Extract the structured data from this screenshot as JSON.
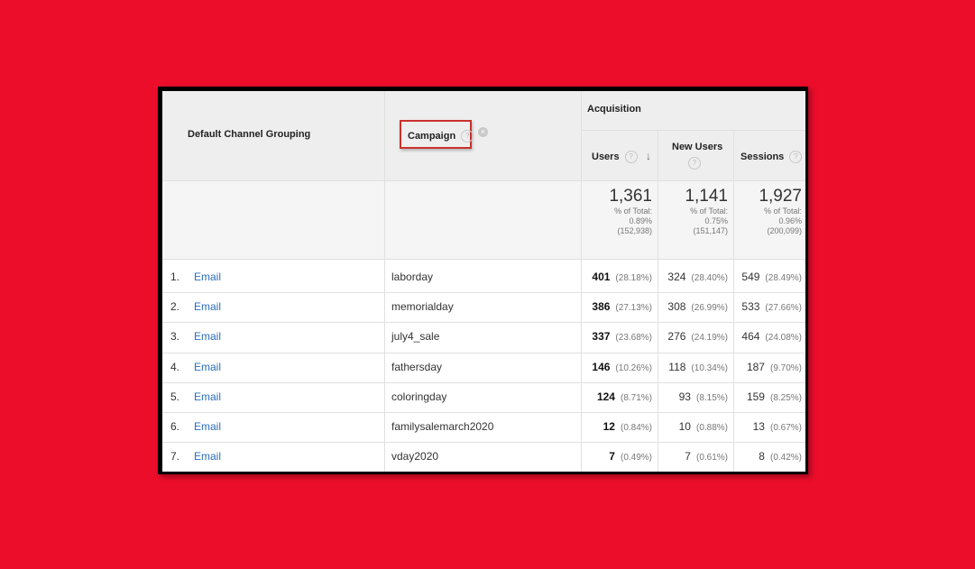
{
  "header": {
    "dimension1": "Default Channel Grouping",
    "dimension2": "Campaign",
    "group": "Acquisition",
    "metric_users": "Users",
    "metric_new_users": "New Users",
    "metric_sessions": "Sessions",
    "help_glyph": "?",
    "remove_glyph": "×",
    "sort_glyph": "↓"
  },
  "totals": {
    "users": {
      "value": "1,361",
      "label": "% of Total:",
      "pct": "0.89%",
      "abs": "(152,938)"
    },
    "new_users": {
      "value": "1,141",
      "label": "% of Total:",
      "pct": "0.75%",
      "abs": "(151,147)"
    },
    "sessions": {
      "value": "1,927",
      "label": "% of Total:",
      "pct": "0.96%",
      "abs": "(200,099)"
    }
  },
  "rows": [
    {
      "num": "1.",
      "channel": "Email",
      "campaign": "laborday",
      "users": "401",
      "users_pct": "(28.18%)",
      "new_users": "324",
      "new_users_pct": "(28.40%)",
      "sessions": "549",
      "sessions_pct": "(28.49%)"
    },
    {
      "num": "2.",
      "channel": "Email",
      "campaign": "memorialday",
      "users": "386",
      "users_pct": "(27.13%)",
      "new_users": "308",
      "new_users_pct": "(26.99%)",
      "sessions": "533",
      "sessions_pct": "(27.66%)"
    },
    {
      "num": "3.",
      "channel": "Email",
      "campaign": "july4_sale",
      "users": "337",
      "users_pct": "(23.68%)",
      "new_users": "276",
      "new_users_pct": "(24.19%)",
      "sessions": "464",
      "sessions_pct": "(24.08%)"
    },
    {
      "num": "4.",
      "channel": "Email",
      "campaign": "fathersday",
      "users": "146",
      "users_pct": "(10.26%)",
      "new_users": "118",
      "new_users_pct": "(10.34%)",
      "sessions": "187",
      "sessions_pct": "(9.70%)"
    },
    {
      "num": "5.",
      "channel": "Email",
      "campaign": "coloringday",
      "users": "124",
      "users_pct": "(8.71%)",
      "new_users": "93",
      "new_users_pct": "(8.15%)",
      "sessions": "159",
      "sessions_pct": "(8.25%)"
    },
    {
      "num": "6.",
      "channel": "Email",
      "campaign": "familysalemarch2020",
      "users": "12",
      "users_pct": "(0.84%)",
      "new_users": "10",
      "new_users_pct": "(0.88%)",
      "sessions": "13",
      "sessions_pct": "(0.67%)"
    },
    {
      "num": "7.",
      "channel": "Email",
      "campaign": "vday2020",
      "users": "7",
      "users_pct": "(0.49%)",
      "new_users": "7",
      "new_users_pct": "(0.61%)",
      "sessions": "8",
      "sessions_pct": "(0.42%)"
    }
  ],
  "colors": {
    "background": "#ec0d2b",
    "link": "#2a6ebb",
    "highlight_box": "#c9302c"
  }
}
